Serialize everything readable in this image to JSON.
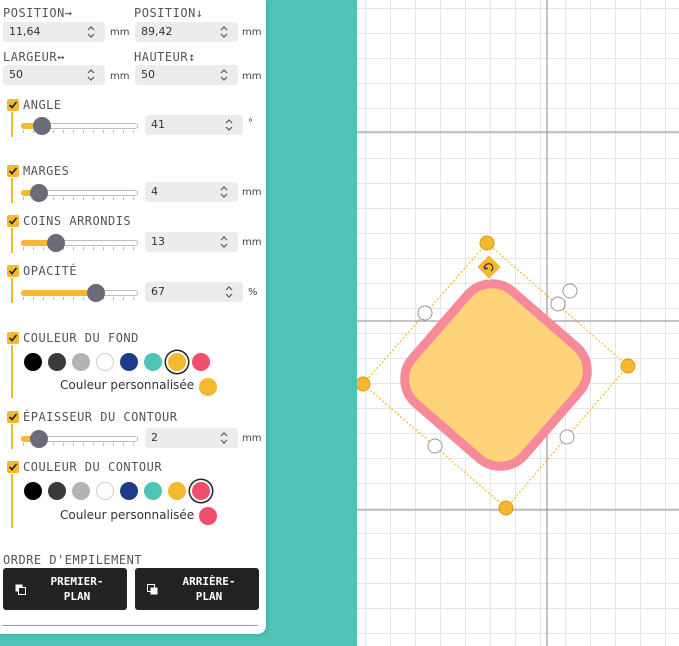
{
  "geometry": {
    "position_x": {
      "label": "POSITION→",
      "value": "11,64",
      "unit": "mm"
    },
    "position_y": {
      "label": "POSITION↓",
      "value": "89,42",
      "unit": "mm"
    },
    "width": {
      "label": "LARGEUR↔",
      "value": "50",
      "unit": "mm"
    },
    "height": {
      "label": "HAUTEUR↕",
      "value": "50",
      "unit": "mm"
    }
  },
  "angle": {
    "label": "ANGLE",
    "value": "41",
    "unit": "°",
    "level": 0.18
  },
  "margins": {
    "label": "MARGES",
    "value": "4",
    "unit": "mm",
    "level": 0.15
  },
  "rounded_corners": {
    "label": "COINS ARRONDIS",
    "value": "13",
    "unit": "mm",
    "level": 0.3
  },
  "opacity": {
    "label": "OPACITÉ",
    "value": "67",
    "unit": "%",
    "level": 0.64
  },
  "fill_color": {
    "label": "COULEUR DU FOND",
    "swatches": [
      "#000000",
      "#3a3a3a",
      "#b4b4b4",
      "#ffffff",
      "#1e3a8a",
      "#4fc3b5",
      "#f5b82e",
      "#f0506e"
    ],
    "selected": 6,
    "custom_label": "Couleur personnalisée",
    "custom_color": "#f5b82e"
  },
  "stroke_width": {
    "label": "ÉPAISSEUR DU CONTOUR",
    "value": "2",
    "unit": "mm",
    "level": 0.15
  },
  "stroke_color": {
    "label": "COULEUR DU CONTOUR",
    "swatches": [
      "#000000",
      "#3a3a3a",
      "#b4b4b4",
      "#ffffff",
      "#1e3a8a",
      "#4fc3b5",
      "#f5b82e",
      "#f0506e"
    ],
    "selected": 7,
    "custom_label": "Couleur personnalisée",
    "custom_color": "#f0506e"
  },
  "stacking": {
    "label": "ORDRE D'EMPILEMENT",
    "front_button": "PREMIER-\nPLAN",
    "back_button": "ARRIÈRE-\nPLAN"
  },
  "colors": {
    "accent": "#f5b82e",
    "teal": "#4fc3b5",
    "shape_fill": "#ffd37a",
    "shape_stroke": "#f78a9a",
    "selection_handle": "#f5b82e"
  },
  "icons": {
    "checkbox": "check-icon",
    "spinner": "chevron-up-down-icon",
    "front": "bring-front-icon",
    "back": "send-back-icon",
    "rotate": "rotate-icon"
  }
}
